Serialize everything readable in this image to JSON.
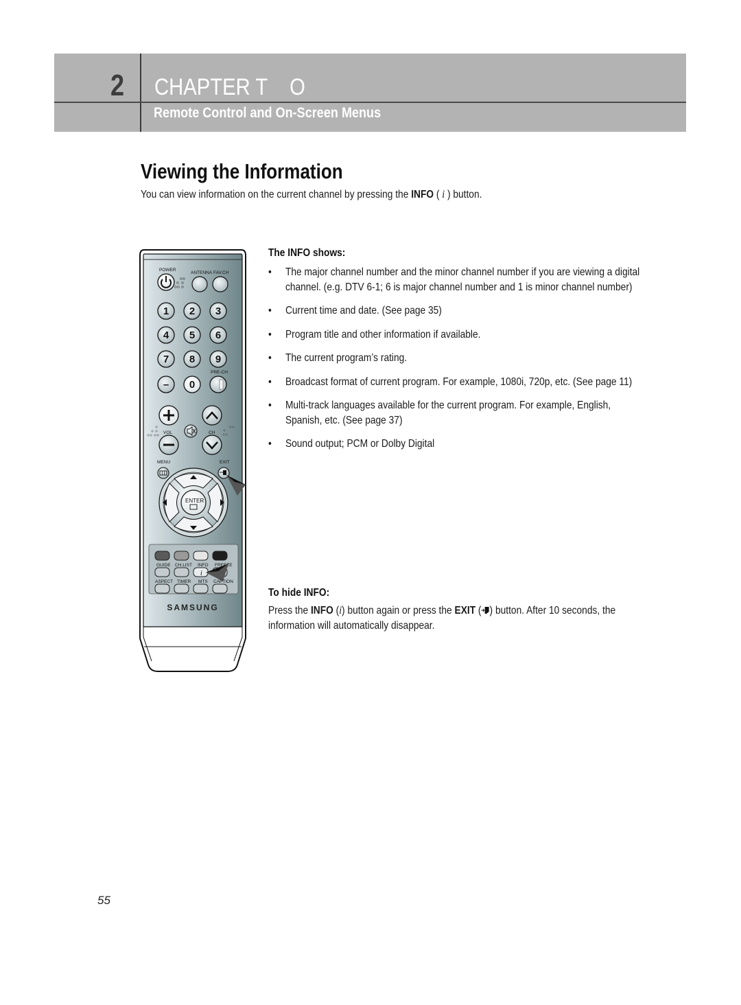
{
  "chapter": {
    "number": "2",
    "title": "CHAPTER T    O",
    "subtitle": "Remote Control and On-Screen Menus",
    "band_color": "#b3b3b3",
    "number_color": "#3d3d3d",
    "title_color": "#ffffff"
  },
  "section": {
    "title": "Viewing the Information",
    "intro_before": "You can view information on the current channel by pressing the ",
    "intro_bold": "INFO",
    "intro_paren_open": " ( ",
    "intro_icon": "i",
    "intro_after": " ) button."
  },
  "info_shows": {
    "heading": "The INFO shows:",
    "bullet_glyph": "•",
    "items": [
      "The major channel number and the minor channel number if you are viewing a digital channel. (e.g. DTV 6-1; 6 is major channel number and 1 is minor channel number)",
      "Current time and date. (See page 35)",
      "Program title and other information if available.",
      "The current program’s rating.",
      "Broadcast format of current program.  For example, 1080i, 720p, etc. (See page 11)",
      "Multi-track languages available for the current program.  For example, English, Spanish, etc. (See page 37)",
      "Sound output; PCM or Dolby Digital"
    ]
  },
  "to_hide": {
    "heading": "To hide INFO:",
    "text_1": "Press the ",
    "bold_info": "INFO",
    "paren_1": " (",
    "info_icon": "i",
    "text_2": ") button again or press the ",
    "bold_exit": "EXIT",
    "paren_2": " (",
    "exit_icon": "exit-icon",
    "text_3": ") button. After 10 seconds, the information will automatically disappear."
  },
  "remote": {
    "brand": "SAMSUNG",
    "labels": {
      "power": "POWER",
      "antenna": "ANTENNA",
      "fav_ch": "FAV.CH",
      "pre_ch": "PRE-CH",
      "vol": "VOL",
      "ch": "CH",
      "menu": "MENU",
      "exit": "EXIT",
      "enter": "ENTER",
      "guide": "GUIDE",
      "ch_list": "CH.LIST",
      "info": "INFO",
      "freeze": "FREEZE",
      "aspect": "ASPECT",
      "timer": "TIMER",
      "mts": "MTS",
      "caption": "CAPTION"
    },
    "digits": [
      "1",
      "2",
      "3",
      "4",
      "5",
      "6",
      "7",
      "8",
      "9",
      "–",
      "0"
    ],
    "color_buttons": [
      "#5a5a5a",
      "#9a9a9a",
      "#e6e6e6",
      "#1e1e1e"
    ]
  },
  "page": {
    "number": "55"
  }
}
